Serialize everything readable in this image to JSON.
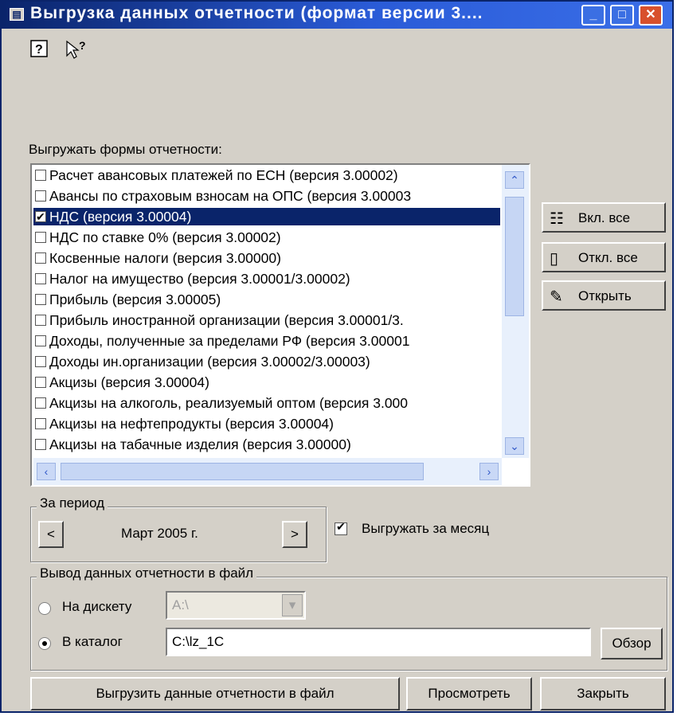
{
  "window": {
    "title": "Выгрузка данных отчетности (формат версии 3....",
    "controls": [
      "minimize",
      "maximize",
      "close"
    ]
  },
  "toolbar": {
    "icons": [
      "help-icon",
      "context-help-icon"
    ]
  },
  "forms_label": "Выгружать формы отчетности:",
  "forms": [
    {
      "label": "Расчет авансовых платежей по ЕСН (версия 3.00002)",
      "checked": false,
      "selected": false
    },
    {
      "label": "Авансы по страховым взносам на ОПС (версия 3.00003",
      "checked": false,
      "selected": false
    },
    {
      "label": "НДС (версия 3.00004)",
      "checked": true,
      "selected": true
    },
    {
      "label": "НДС по ставке 0% (версия 3.00002)",
      "checked": false,
      "selected": false
    },
    {
      "label": "Косвенные налоги (версия 3.00000)",
      "checked": false,
      "selected": false
    },
    {
      "label": "Налог на имущество (версия 3.00001/3.00002)",
      "checked": false,
      "selected": false
    },
    {
      "label": "Прибыль (версия 3.00005)",
      "checked": false,
      "selected": false
    },
    {
      "label": "Прибыль иностранной организации (версия 3.00001/3.",
      "checked": false,
      "selected": false
    },
    {
      "label": "Доходы, полученные за пределами РФ (версия 3.00001",
      "checked": false,
      "selected": false
    },
    {
      "label": "Доходы ин.организации (версия 3.00002/3.00003)",
      "checked": false,
      "selected": false
    },
    {
      "label": "Акцизы (версия 3.00004)",
      "checked": false,
      "selected": false
    },
    {
      "label": "Акцизы на алкоголь, реализуемый оптом (версия 3.000",
      "checked": false,
      "selected": false
    },
    {
      "label": "Акцизы на нефтепродукты (версия 3.00004)",
      "checked": false,
      "selected": false
    },
    {
      "label": "Акцизы на табачные изделия (версия 3.00000)",
      "checked": false,
      "selected": false
    }
  ],
  "side_buttons": {
    "enable_all": "Вкл. все",
    "disable_all": "Откл. все",
    "open": "Открыть"
  },
  "period": {
    "legend": "За период",
    "prev": "<",
    "value": "Март 2005 г.",
    "next": ">",
    "by_month_label": "Выгружать за месяц",
    "by_month_checked": true
  },
  "output": {
    "legend": "Вывод данных отчетности в файл",
    "floppy_label": "На дискету",
    "floppy_value": "A:\\",
    "floppy_selected": false,
    "folder_label": "В каталог",
    "folder_value": "C:\\lz_1C",
    "folder_selected": true,
    "browse": "Обзор"
  },
  "bottom_buttons": {
    "export": "Выгрузить данные отчетности в файл",
    "preview": "Просмотреть",
    "close": "Закрыть"
  }
}
